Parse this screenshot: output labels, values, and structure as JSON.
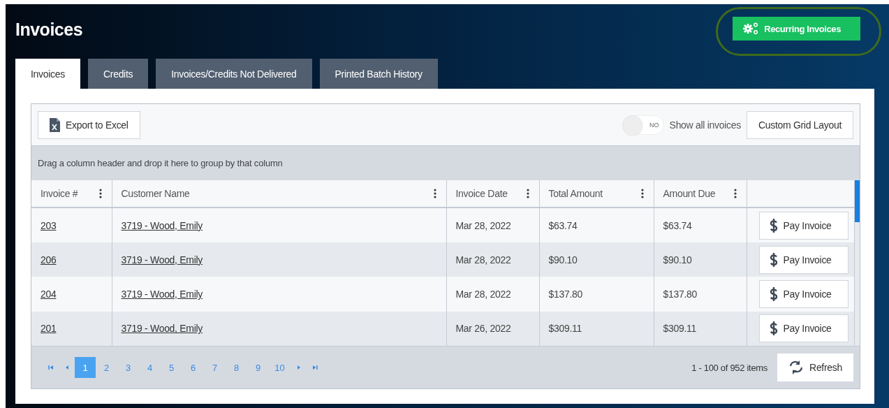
{
  "page_title": "Invoices",
  "recurring_button": {
    "label": "Recurring Invoices",
    "highlighted": true
  },
  "tabs": [
    {
      "label": "Invoices",
      "selected": true
    },
    {
      "label": "Credits",
      "selected": false
    },
    {
      "label": "Invoices/Credits Not Delivered",
      "selected": false
    },
    {
      "label": "Printed Batch History",
      "selected": false
    }
  ],
  "toolbar": {
    "export_button": "Export to Excel",
    "toggle": {
      "label": "NO",
      "on": false
    },
    "toggle_caption": "Show all invoices",
    "layout_button": "Custom Grid Layout"
  },
  "group_hint": "Drag a column header and drop it here to group by that column",
  "columns": [
    {
      "label": "Invoice #"
    },
    {
      "label": "Customer Name"
    },
    {
      "label": "Invoice Date"
    },
    {
      "label": "Total Amount"
    },
    {
      "label": "Amount Due"
    }
  ],
  "rows": [
    {
      "invoice": "203",
      "customer": "3719 - Wood, Emily",
      "date": "Mar 28, 2022",
      "total": "$63.74",
      "due": "$63.74",
      "action": "Pay Invoice"
    },
    {
      "invoice": "206",
      "customer": "3719 - Wood, Emily",
      "date": "Mar 28, 2022",
      "total": "$90.10",
      "due": "$90.10",
      "action": "Pay Invoice"
    },
    {
      "invoice": "204",
      "customer": "3719 - Wood, Emily",
      "date": "Mar 28, 2022",
      "total": "$137.80",
      "due": "$137.80",
      "action": "Pay Invoice"
    },
    {
      "invoice": "201",
      "customer": "3719 - Wood, Emily",
      "date": "Mar 26, 2022",
      "total": "$309.11",
      "due": "$309.11",
      "action": "Pay Invoice"
    }
  ],
  "pager": {
    "pages": [
      {
        "label": "1",
        "selected": true
      },
      {
        "label": "2",
        "selected": false
      },
      {
        "label": "3",
        "selected": false
      },
      {
        "label": "4",
        "selected": false
      },
      {
        "label": "5",
        "selected": false
      },
      {
        "label": "6",
        "selected": false
      },
      {
        "label": "7",
        "selected": false
      },
      {
        "label": "8",
        "selected": false
      },
      {
        "label": "9",
        "selected": false
      },
      {
        "label": "10",
        "selected": false
      }
    ],
    "summary": "1 - 100 of 952 items",
    "refresh_button": "Refresh"
  }
}
